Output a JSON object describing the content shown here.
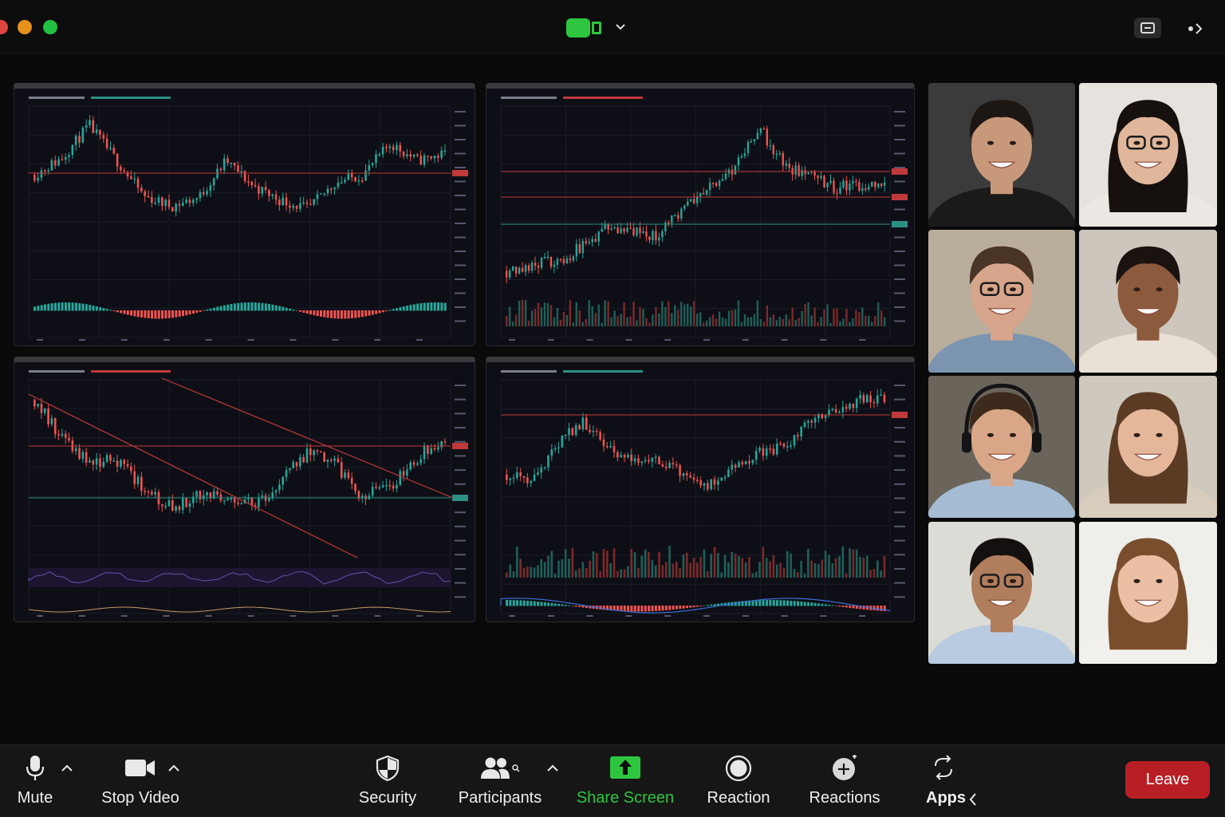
{
  "window": {
    "traffic_lights": [
      "#e0443e",
      "#e8901c",
      "#22c040"
    ],
    "share_indicator_color": "#2ec640"
  },
  "shared_screen": {
    "colors": {
      "up": "#26a69a",
      "down": "#ef5350",
      "background": "#0e0f16",
      "grid": "#1a1c26"
    }
  },
  "participants": [
    {
      "id": "p1",
      "icon": "person-video-tile",
      "bg": "#3b3b3b",
      "skin": "#c8987a",
      "hair": "#1d1714",
      "shirt": "#1a1a1a",
      "glasses": false,
      "headphones": false
    },
    {
      "id": "p2",
      "icon": "person-video-tile",
      "bg": "#e6e3df",
      "skin": "#e1b79b",
      "hair": "#16110e",
      "shirt": "#ebe8e3",
      "glasses": true,
      "headphones": false
    },
    {
      "id": "p3",
      "icon": "person-video-tile",
      "bg": "#b9ad9c",
      "skin": "#d7a58b",
      "hair": "#4a3426",
      "shirt": "#7b94b0",
      "glasses": true,
      "headphones": false
    },
    {
      "id": "p4",
      "icon": "person-video-tile",
      "bg": "#cdc6bc",
      "skin": "#8c5a3c",
      "hair": "#1b1310",
      "shirt": "#e9e1d5",
      "glasses": false,
      "headphones": false
    },
    {
      "id": "p5",
      "icon": "person-video-tile",
      "bg": "#6a645b",
      "skin": "#d9a788",
      "hair": "#3d2a1c",
      "shirt": "#a6bcd3",
      "glasses": false,
      "headphones": true
    },
    {
      "id": "p6",
      "icon": "person-video-tile",
      "bg": "#cfc8bd",
      "skin": "#e4b69a",
      "hair": "#5b3b24",
      "shirt": "#d8cdbd",
      "glasses": false,
      "headphones": false
    },
    {
      "id": "p7",
      "icon": "person-video-tile",
      "bg": "#dcdcd6",
      "skin": "#b07e5c",
      "hair": "#141010",
      "shirt": "#b9cbe0",
      "glasses": true,
      "headphones": false
    },
    {
      "id": "p8",
      "icon": "person-video-tile",
      "bg": "#eeeeea",
      "skin": "#ebbfa4",
      "hair": "#7a4e2d",
      "shirt": "#f2f0ec",
      "glasses": false,
      "headphones": false
    }
  ],
  "toolbar": {
    "mute": {
      "label": "Mute",
      "icon": "microphone-icon"
    },
    "video": {
      "label": "Stop Video",
      "icon": "video-camera-icon"
    },
    "security": {
      "label": "Security",
      "icon": "shield-icon"
    },
    "participants": {
      "label": "Participants",
      "icon": "participants-icon"
    },
    "share": {
      "label": "Share Screen",
      "icon": "share-screen-icon",
      "color": "#2ec640"
    },
    "reaction": {
      "label": "Reaction",
      "icon": "record-icon"
    },
    "reactions": {
      "label": "Reactions",
      "icon": "add-reaction-icon"
    },
    "apps": {
      "label": "Apps",
      "icon": "apps-icon"
    },
    "leave": {
      "label": "Leave",
      "color": "#b81f24"
    }
  }
}
